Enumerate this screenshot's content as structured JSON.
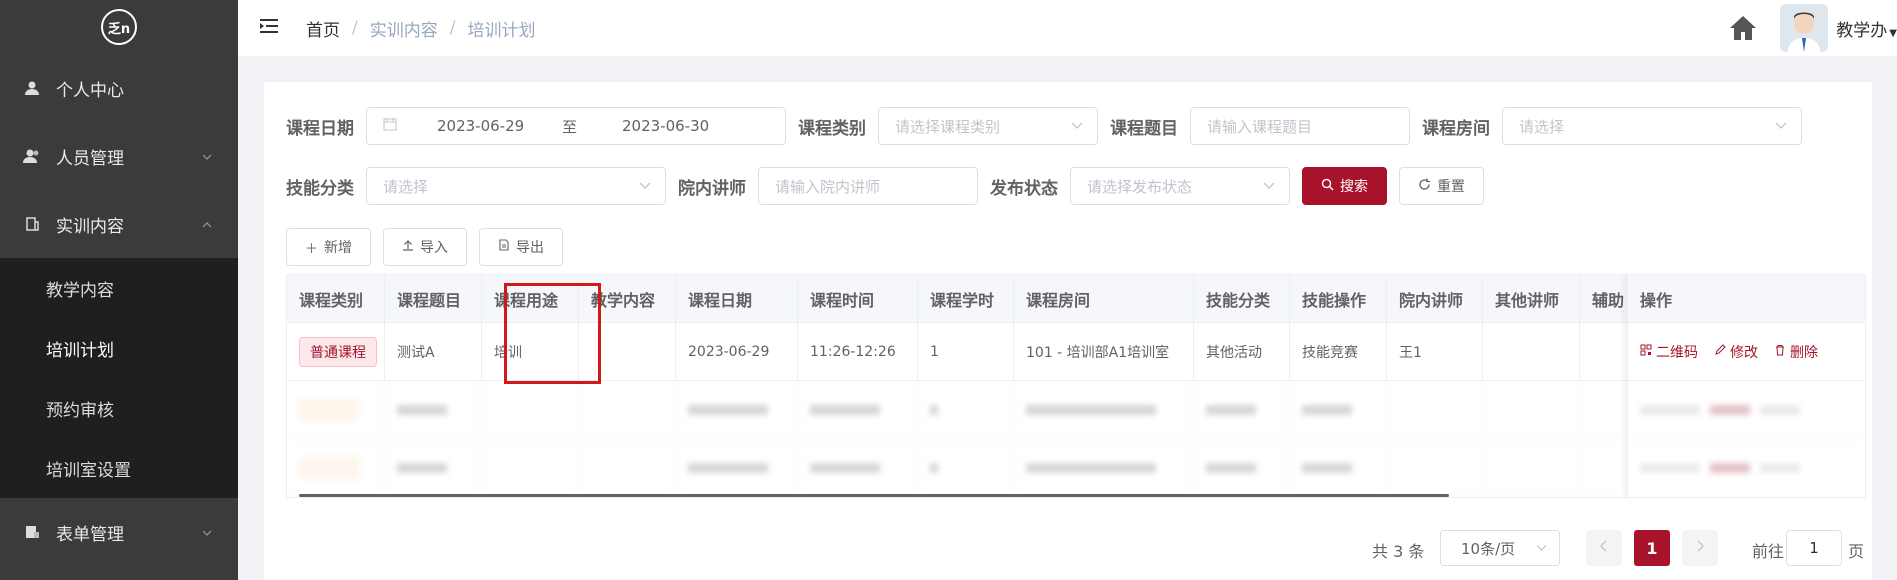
{
  "sidebar": {
    "logo_text": "乏n",
    "items": [
      {
        "label": "个人中心"
      },
      {
        "label": "人员管理"
      },
      {
        "label": "实训内容"
      },
      {
        "label": "表单管理"
      }
    ],
    "sub_items": [
      {
        "label": "教学内容"
      },
      {
        "label": "培训计划"
      },
      {
        "label": "预约审核"
      },
      {
        "label": "培训室设置"
      }
    ]
  },
  "header": {
    "breadcrumb": [
      "首页",
      "实训内容",
      "培训计划"
    ],
    "breadcrumb_sep": "/",
    "user_name": "教学办"
  },
  "filters": {
    "date_label": "课程日期",
    "date_start": "2023-06-29",
    "date_to": "至",
    "date_end": "2023-06-30",
    "category_label": "课程类别",
    "category_placeholder": "请选择课程类别",
    "topic_label": "课程题目",
    "topic_placeholder": "请输入课程题目",
    "room_label": "课程房间",
    "room_placeholder": "请选择",
    "skill_label": "技能分类",
    "skill_placeholder": "请选择",
    "lecturer_label": "院内讲师",
    "lecturer_placeholder": "请输入院内讲师",
    "status_label": "发布状态",
    "status_placeholder": "请选择发布状态",
    "search_btn": "搜索",
    "reset_btn": "重置"
  },
  "toolbar": {
    "add": "新增",
    "import": "导入",
    "export": "导出"
  },
  "table": {
    "columns": [
      "课程类别",
      "课程题目",
      "课程用途",
      "教学内容",
      "课程日期",
      "课程时间",
      "课程学时",
      "课程房间",
      "技能分类",
      "技能操作",
      "院内讲师",
      "其他讲师",
      "辅助"
    ],
    "op_header": "操作",
    "rows": [
      {
        "category": "普通课程",
        "topic": "测试A",
        "usage": "培训",
        "content": "",
        "date": "2023-06-29",
        "time": "11:26-12:26",
        "hours": "1",
        "room": "101 - 培训部A1培训室",
        "skill": "其他活动",
        "skill_op": "技能竞赛",
        "lecturer": "王1",
        "other": ""
      },
      {
        "category": "",
        "topic": "",
        "usage": "",
        "content": "",
        "date": "",
        "time": "",
        "hours": "",
        "room": "",
        "skill": "",
        "skill_op": "",
        "lecturer": "",
        "other": ""
      },
      {
        "category": "",
        "topic": "",
        "usage": "",
        "content": "",
        "date": "",
        "time": "",
        "hours": "",
        "room": "",
        "skill": "",
        "skill_op": "",
        "lecturer": "",
        "other": ""
      }
    ],
    "ops": {
      "qrcode": "二维码",
      "edit": "修改",
      "delete": "删除"
    }
  },
  "pagination": {
    "total": "共 3 条",
    "page_size": "10条/页",
    "current": "1",
    "goto": "前往",
    "goto_value": "1",
    "page_word": "页"
  },
  "colors": {
    "accent": "#a8132b",
    "sidebar": "#3b3b3b",
    "submenu": "#1f1f1f"
  }
}
